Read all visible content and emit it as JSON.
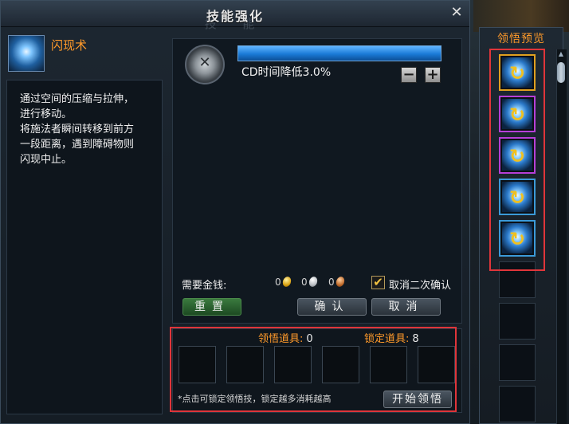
{
  "dialog": {
    "title": "技能强化",
    "title_background": "技 能",
    "close_glyph": "✕"
  },
  "skill": {
    "name": "闪现术",
    "description": [
      "通过空间的压缩与拉伸，",
      "进行移动。",
      "将施法者瞬间转移到前方",
      "一段距离，遇到障碍物则",
      "闪现中止。"
    ]
  },
  "effect": {
    "text": "CD时间降低3.0%",
    "progress_percent": 100
  },
  "cost": {
    "label": "需要金钱:",
    "gold": "0",
    "silver": "0",
    "copper": "0"
  },
  "cancel_confirm": {
    "checked": true,
    "label": "取消二次确认"
  },
  "buttons": {
    "reset": "重置",
    "confirm": "确认",
    "cancel": "取消",
    "start": "开始领悟",
    "minus": "−",
    "plus": "+"
  },
  "items": {
    "enlighten_label": "领悟道具:",
    "enlighten_count": "0",
    "lock_label": "锁定道具:",
    "lock_count": "8",
    "hint": "*点击可锁定领悟技，锁定越多消耗越高"
  },
  "preview": {
    "title": "领悟预览",
    "scroll_up": "▲"
  },
  "colors": {
    "accent_orange": "#ff9a2a",
    "highlight_red": "#e0353a",
    "progress_blue": "#1a7ad6"
  }
}
